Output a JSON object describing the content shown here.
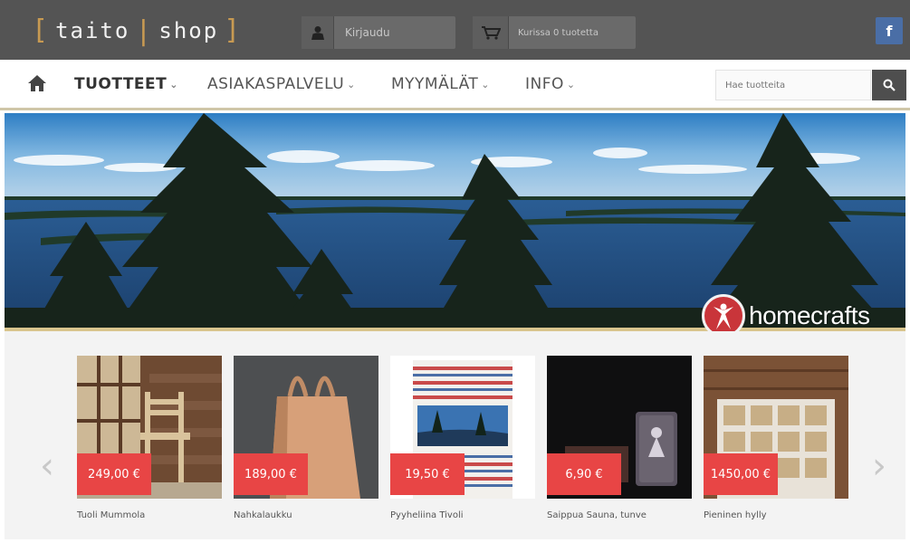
{
  "header": {
    "logo_word_1": "taito",
    "logo_word_2": "shop",
    "login_label": "Kirjaudu",
    "cart_label": "Kurissa 0 tuotetta",
    "facebook_label": "f"
  },
  "nav": {
    "items": [
      {
        "label": "TUOTTEET",
        "active": true
      },
      {
        "label": "ASIAKASPALVELU",
        "active": false
      },
      {
        "label": "MYYMÄLÄT",
        "active": false
      },
      {
        "label": "INFO",
        "active": false
      }
    ],
    "search_placeholder": "Hae tuotteita"
  },
  "hero": {
    "brand_text": "homecrafts"
  },
  "products": [
    {
      "name": "Tuoli Mummola",
      "price": "249,00 €"
    },
    {
      "name": "Nahkalaukku",
      "price": "189,00 €"
    },
    {
      "name": "Pyyheliina Tivoli",
      "price": "19,50 €"
    },
    {
      "name": "Saippua Sauna, tunve",
      "price": "6,90 €"
    },
    {
      "name": "Pieninen hylly",
      "price": "1450,00 €"
    }
  ],
  "carousel": {
    "prev_glyph": "‹",
    "next_glyph": "›"
  },
  "colors": {
    "topbar": "#545454",
    "accent_gold": "#c89a52",
    "price_red": "#e84545",
    "facebook_blue": "#4a6ea6"
  }
}
